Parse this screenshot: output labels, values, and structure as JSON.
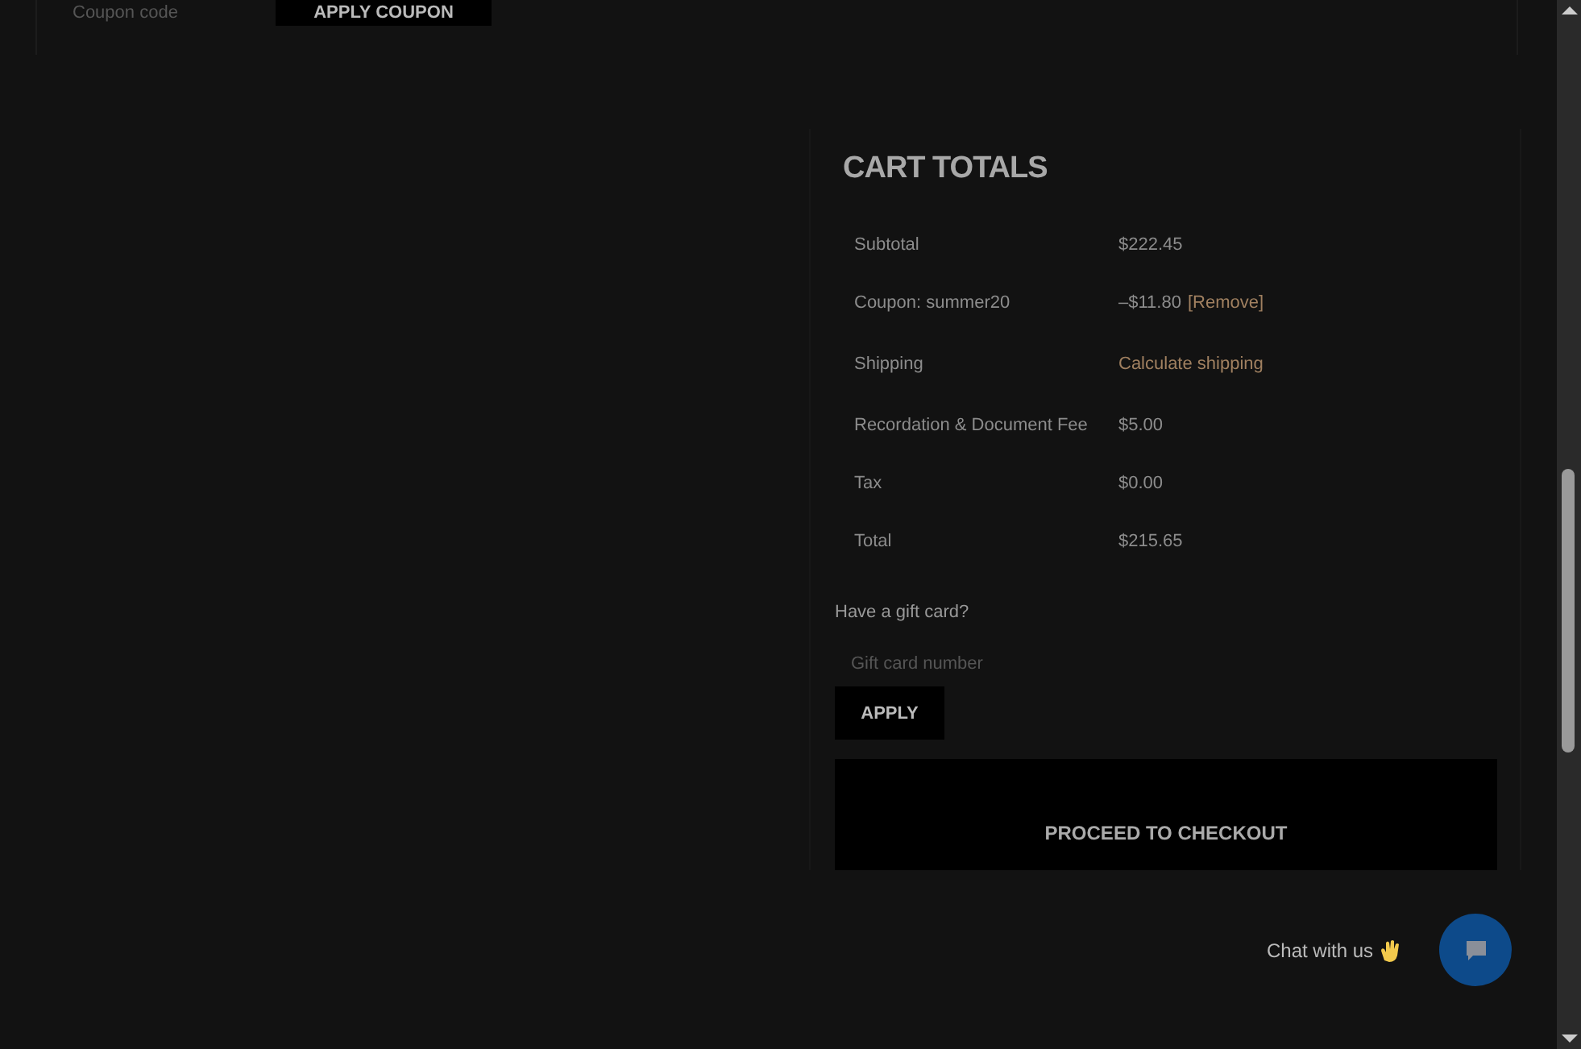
{
  "coupon_form": {
    "label": "Coupon code",
    "button": "APPLY COUPON"
  },
  "cart_totals": {
    "title": "CART TOTALS",
    "rows": [
      {
        "label": "Subtotal",
        "value": "$222.45"
      },
      {
        "label": "Coupon: summer20",
        "value": "–$11.80",
        "link": "[Remove]"
      },
      {
        "label": "Shipping",
        "link": "Calculate shipping"
      },
      {
        "label": "Recordation & Document Fee",
        "value": "$5.00"
      },
      {
        "label": "Tax",
        "value": "$0.00"
      },
      {
        "label": "Total",
        "value": "$215.65"
      }
    ],
    "gift_card": {
      "label": "Have a gift card?",
      "placeholder": "Gift card number",
      "button": "APPLY"
    },
    "checkout_button": "PROCEED TO CHECKOUT"
  },
  "chat": {
    "label": "Chat with us"
  }
}
